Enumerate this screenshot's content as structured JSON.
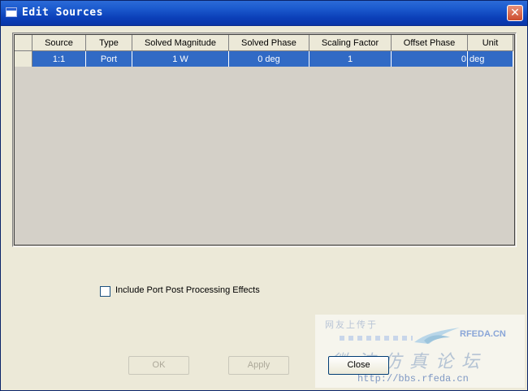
{
  "window": {
    "title": "Edit Sources",
    "close_glyph": "✕"
  },
  "grid": {
    "columns": [
      "Source",
      "Type",
      "Solved Magnitude",
      "Solved Phase",
      "Scaling Factor",
      "Offset Phase",
      "Unit"
    ],
    "rows": [
      [
        "1:1",
        "Port",
        "1 W",
        "0 deg",
        "1",
        "0",
        "deg"
      ]
    ],
    "selected_row_color": "#316ac5"
  },
  "options": {
    "include_port_post_processing_label": "Include Port Post Processing Effects",
    "checked": false
  },
  "buttons": {
    "ok": "OK",
    "apply": "Apply",
    "close": "Close"
  },
  "watermark": {
    "top_text": "网友上传于",
    "brand": "RFEDA.CN",
    "cn_text": "微波仿真论坛",
    "url": "http://bbs.rfeda.cn"
  }
}
